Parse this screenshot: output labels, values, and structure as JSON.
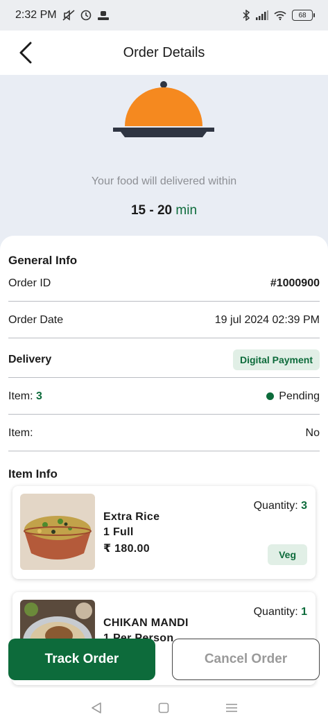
{
  "status_bar": {
    "time": "2:32 PM",
    "battery": "68"
  },
  "app_bar": {
    "title": "Order Details"
  },
  "hero": {
    "message": "Your food will delivered within",
    "eta_range": "15 - 20",
    "eta_unit": "min"
  },
  "general_info": {
    "title": "General Info",
    "order_id_label": "Order ID",
    "order_id_value": "#1000900",
    "order_date_label": "Order Date",
    "order_date_value": "19 jul 2024 02:39 PM",
    "delivery_label": "Delivery",
    "delivery_value": "Digital Payment",
    "item_label": "Item:",
    "item_count": "3",
    "status_value": "Pending",
    "item2_label": "Item:",
    "item2_value": "No"
  },
  "item_info": {
    "title": "Item Info",
    "items": [
      {
        "name": "Extra Rice",
        "portion": "1 Full",
        "price": "₹ 180.00",
        "quantity_label": "Quantity:",
        "quantity": "3",
        "tag": "Veg"
      },
      {
        "name": "CHIKAN MANDI",
        "portion": "1 Per Person",
        "quantity_label": "Quantity:",
        "quantity": "1"
      }
    ]
  },
  "actions": {
    "track_label": "Track Order",
    "cancel_label": "Cancel Order"
  },
  "colors": {
    "primary": "#0d6b3b",
    "cloche_orange": "#f5891f",
    "tray_dark": "#2f3542"
  },
  "icons": {
    "back": "back-arrow-icon",
    "nav_back": "nav-back-icon",
    "nav_home": "nav-home-icon",
    "nav_menu": "nav-menu-icon"
  }
}
